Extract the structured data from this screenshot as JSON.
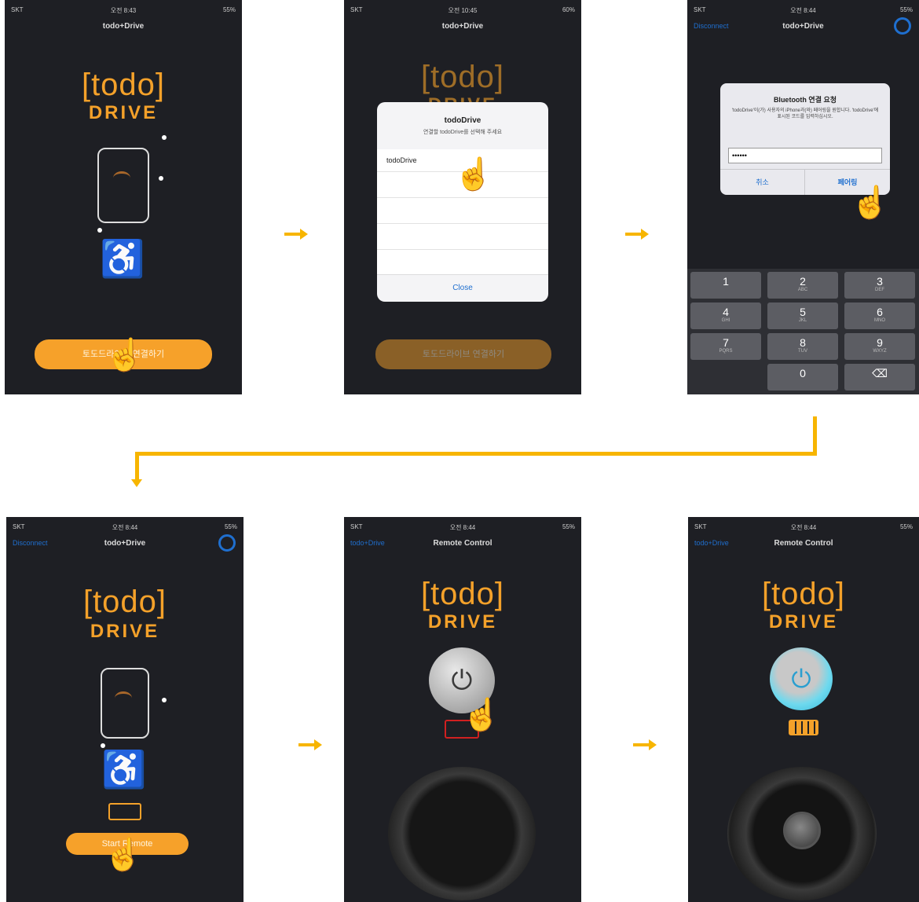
{
  "colors": {
    "accent": "#f4a12a",
    "arrow": "#f7b500",
    "link": "#1f6fcf",
    "bg": "#1e1f24"
  },
  "screen1": {
    "status": {
      "left": "SKT",
      "center": "오전 8:43",
      "right": "55%"
    },
    "title": "todo+Drive",
    "logo_top": "[todo]",
    "logo_bottom": "DRIVE",
    "button": "토도드라이브 연결하기"
  },
  "screen2": {
    "status": {
      "left": "SKT",
      "center": "오전 10:45",
      "right": "60%"
    },
    "title": "todo+Drive",
    "logo_top": "[todo]",
    "logo_bottom": "DRIVE",
    "dialog": {
      "title": "todoDrive",
      "subtitle": "연결할 todoDrive를 선택해 주세요",
      "item": "todoDrive",
      "close": "Close"
    },
    "button": "토도드라이브 연결하기"
  },
  "screen3": {
    "status": {
      "left": "SKT",
      "center": "오전 8:44",
      "right": "55%"
    },
    "nav_left": "Disconnect",
    "title": "todo+Drive",
    "dialog": {
      "title": "Bluetooth 연결 요청",
      "message": "'todoDrive'이(가) 사용자의 iPhone과(와) 페어링을 원합니다. 'todoDrive'에 표시된 코드를 입력하십시오.",
      "field_value": "••••••",
      "cancel": "취소",
      "pair": "페어링"
    },
    "keys": [
      {
        "num": "1",
        "letters": ""
      },
      {
        "num": "2",
        "letters": "ABC"
      },
      {
        "num": "3",
        "letters": "DEF"
      },
      {
        "num": "4",
        "letters": "GHI"
      },
      {
        "num": "5",
        "letters": "JKL"
      },
      {
        "num": "6",
        "letters": "MNO"
      },
      {
        "num": "7",
        "letters": "PQRS"
      },
      {
        "num": "8",
        "letters": "TUV"
      },
      {
        "num": "9",
        "letters": "WXYZ"
      },
      {
        "num": "",
        "letters": ""
      },
      {
        "num": "0",
        "letters": ""
      },
      {
        "num": "⌫",
        "letters": ""
      }
    ]
  },
  "screen4": {
    "status": {
      "left": "SKT",
      "center": "오전 8:44",
      "right": "55%"
    },
    "nav_left": "Disconnect",
    "title": "todo+Drive",
    "logo_top": "[todo]",
    "logo_bottom": "DRIVE",
    "button": "Start Remote"
  },
  "screen5": {
    "status": {
      "left": "SKT",
      "center": "오전 8:44",
      "right": "55%"
    },
    "nav_left": "todo+Drive",
    "title": "Remote Control",
    "logo_top": "[todo]",
    "logo_bottom": "DRIVE",
    "power_icon": "⏻"
  },
  "screen6": {
    "status": {
      "left": "SKT",
      "center": "오전 8:44",
      "right": "55%"
    },
    "nav_left": "todo+Drive",
    "title": "Remote Control",
    "logo_top": "[todo]",
    "logo_bottom": "DRIVE",
    "power_icon": "⏻"
  },
  "icons": {
    "hand": "☝",
    "wheelchair": "♿"
  }
}
